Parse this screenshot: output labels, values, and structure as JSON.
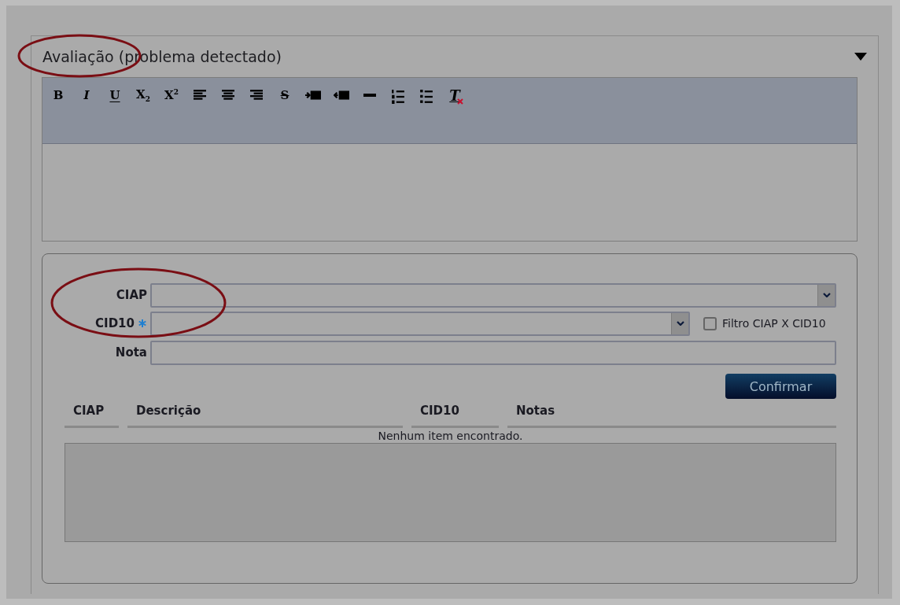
{
  "panel": {
    "title": "Avaliação (problema detectado)",
    "expanded": true
  },
  "toolbar": [
    {
      "kind": "bold",
      "label": "B"
    },
    {
      "kind": "italic",
      "label": "I"
    },
    {
      "kind": "underline",
      "label": "U"
    },
    {
      "kind": "subscript",
      "label": "X",
      "index": "2"
    },
    {
      "kind": "superscript",
      "label": "X",
      "index": "2"
    },
    {
      "kind": "align-left"
    },
    {
      "kind": "align-center"
    },
    {
      "kind": "align-right"
    },
    {
      "kind": "strike",
      "label": "S"
    },
    {
      "kind": "indent"
    },
    {
      "kind": "outdent"
    },
    {
      "kind": "rule"
    },
    {
      "kind": "ordered-list"
    },
    {
      "kind": "bullet-list"
    },
    {
      "kind": "clear-format",
      "label": "T"
    }
  ],
  "fields": [
    {
      "label": "CIAP",
      "kind": "dropdown",
      "required": false
    },
    {
      "label": "CID10",
      "kind": "dropdown",
      "required": true,
      "filter": {
        "label": "Filtro CIAP X CID10",
        "checked": false
      }
    },
    {
      "label": "Nota",
      "kind": "text",
      "required": false
    }
  ],
  "confirm_button": "Confirmar",
  "table": {
    "columns": [
      "CIAP",
      "Descrição",
      "CID10",
      "Notas"
    ],
    "empty_message": "Nenhum item encontrado."
  }
}
